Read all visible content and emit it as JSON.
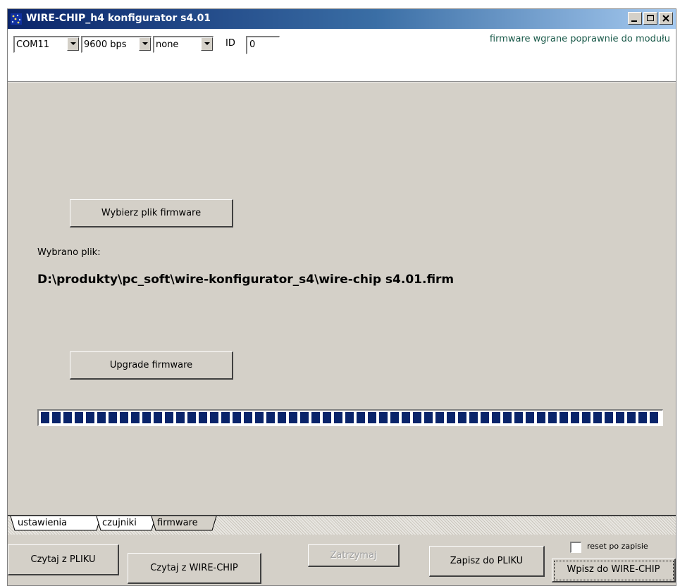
{
  "window": {
    "title": "WIRE-CHIP_h4 konfigurator s4.01"
  },
  "toolbar": {
    "port": "COM11",
    "baud": "9600 bps",
    "parity": "none",
    "id_label": "ID",
    "id_value": "0",
    "status": "firmware wgrane poprawnie do modułu"
  },
  "firmware": {
    "choose_button": "Wybierz plik firmware",
    "selected_label": "Wybrano plik:",
    "selected_path": "D:\\produkty\\pc_soft\\wire-konfigurator_s4\\wire-chip s4.01.firm",
    "upgrade_button": "Upgrade firmware",
    "progress": 1.0
  },
  "tabs": [
    {
      "label": "ustawienia"
    },
    {
      "label": "czujniki"
    },
    {
      "label": "firmware"
    }
  ],
  "bottom": {
    "read_file": "Czytaj z PLIKU",
    "read_chip": "Czytaj z WIRE-CHIP",
    "stop": "Zatrzymaj",
    "save_file": "Zapisz do PLIKU",
    "write_chip": "Wpisz do WIRE-CHIP",
    "reset_label": "reset po zapisie"
  },
  "colors": {
    "progress_block": "#0a246a",
    "title_start": "#0a246a",
    "title_end": "#a6caf0"
  }
}
